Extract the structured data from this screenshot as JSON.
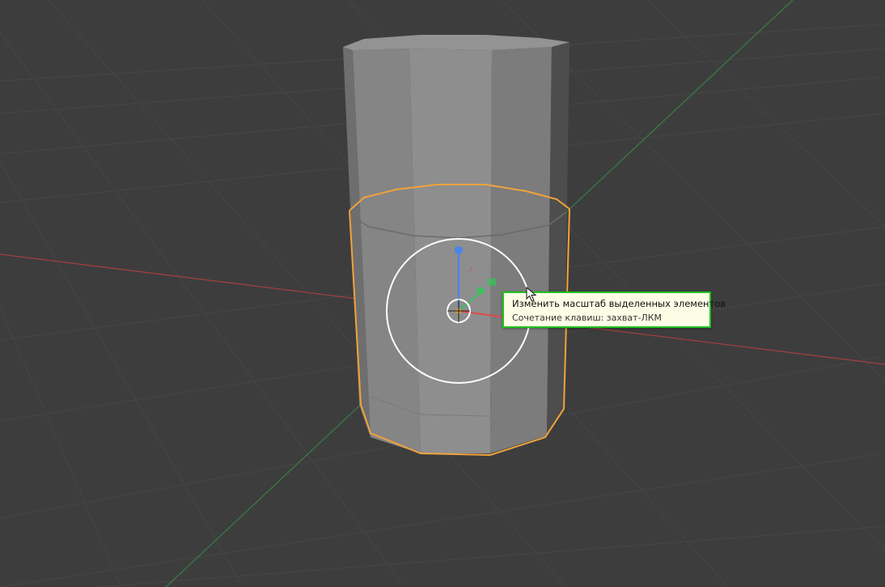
{
  "viewport": {
    "background_color": "#3d3d3d",
    "grid_color": "#464646",
    "x_axis_color": "#a13f3f",
    "y_axis_color": "#3a7a45",
    "selection_outline_color": "#f1a33a",
    "mesh_color": "#8a8a8a"
  },
  "gizmo": {
    "z_handle_color": "#4a84e6",
    "y_handle_color": "#38c25b",
    "x_handle_color": "#e04a4a",
    "pivot_color": "#e09a2c",
    "ring_color": "#ffffff"
  },
  "tooltip": {
    "title": "Изменить масштаб выделенных элементов",
    "shortcut": "Сочетание клавиш: захват-ЛКМ",
    "border_color": "#21c21f",
    "background_color": "#fdfde6"
  },
  "cursor": {
    "icon": "arrow-pointer-icon"
  }
}
